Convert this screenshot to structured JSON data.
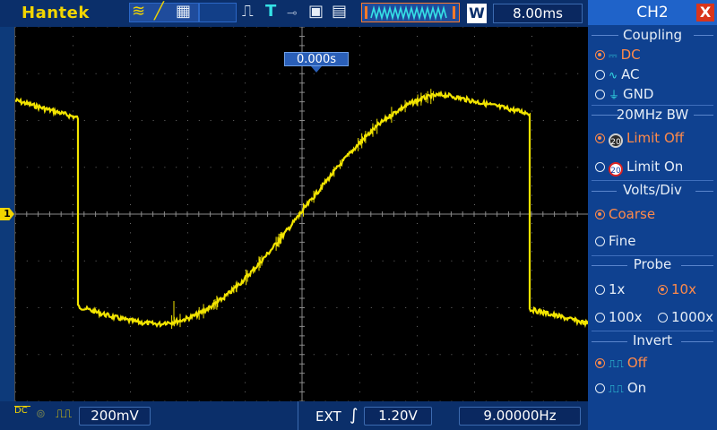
{
  "brand": "Hantek",
  "toolbar": {
    "timebase": "8.00ms",
    "w_button": "W",
    "t_label": "T"
  },
  "trigger_position": "0.000s",
  "channel_marker": "1",
  "bottom": {
    "volts_per_div": "200mV",
    "trigger_source": "EXT",
    "trigger_level": "1.20V",
    "frequency": "9.00000Hz",
    "coupling_icon": "DC"
  },
  "menu": {
    "title": "CH2",
    "close": "X",
    "coupling": {
      "title": "Coupling",
      "options": [
        {
          "label": "DC",
          "selected": true
        },
        {
          "label": "AC",
          "selected": false
        },
        {
          "label": "GND",
          "selected": false
        }
      ]
    },
    "bw": {
      "title": "20MHz BW",
      "ring_label": "20",
      "options": [
        {
          "label": "Limit Off",
          "selected": true
        },
        {
          "label": "Limit On",
          "selected": false
        }
      ]
    },
    "volts": {
      "title": "Volts/Div",
      "options": [
        {
          "label": "Coarse",
          "selected": true
        },
        {
          "label": "Fine",
          "selected": false
        }
      ]
    },
    "probe": {
      "title": "Probe",
      "options": [
        {
          "label": "1x",
          "selected": false
        },
        {
          "label": "10x",
          "selected": true
        },
        {
          "label": "100x",
          "selected": false
        },
        {
          "label": "1000x",
          "selected": false
        }
      ]
    },
    "invert": {
      "title": "Invert",
      "options": [
        {
          "label": "Off",
          "selected": true
        },
        {
          "label": "On",
          "selected": false
        }
      ]
    }
  },
  "colors": {
    "trace": "#f2e400",
    "accent_selected": "#ff8a4a",
    "brand": "#f2d500"
  }
}
